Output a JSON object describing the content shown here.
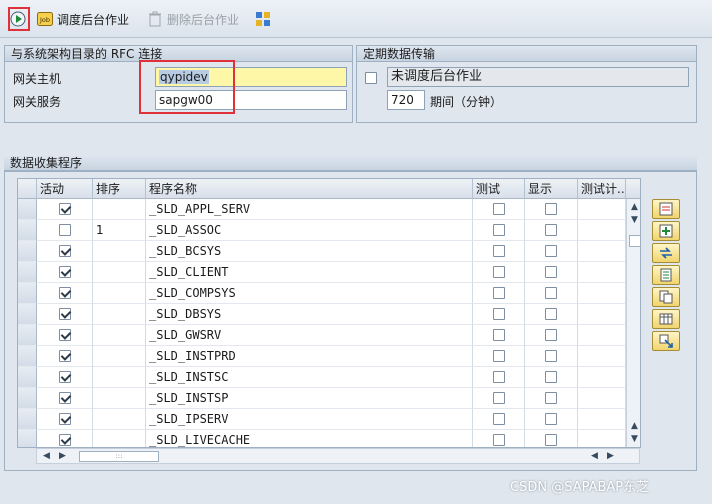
{
  "toolbar": {
    "schedule_label": "调度后台作业",
    "delete_label": "删除后台作业"
  },
  "rfc_group": {
    "title": "与系统架构目录的 RFC 连接",
    "host_label": "网关主机",
    "host_value": "qypidev",
    "service_label": "网关服务",
    "service_value": "sapgw00"
  },
  "periodic_group": {
    "title": "定期数据传输",
    "status_text": "未调度后台作业",
    "interval_value": "720",
    "interval_label": "期间（分钟）"
  },
  "collector_group": {
    "title": "数据收集程序",
    "columns": [
      "活动",
      "排序",
      "程序名称",
      "测试",
      "显示",
      "测试计..."
    ],
    "rows": [
      {
        "active": true,
        "order": "",
        "name": "_SLD_APPL_SERV",
        "test": false,
        "display": false
      },
      {
        "active": false,
        "order": "1",
        "name": "_SLD_ASSOC",
        "test": false,
        "display": false
      },
      {
        "active": true,
        "order": "",
        "name": "_SLD_BCSYS",
        "test": false,
        "display": false
      },
      {
        "active": true,
        "order": "",
        "name": "_SLD_CLIENT",
        "test": false,
        "display": false
      },
      {
        "active": true,
        "order": "",
        "name": "_SLD_COMPSYS",
        "test": false,
        "display": false
      },
      {
        "active": true,
        "order": "",
        "name": "_SLD_DBSYS",
        "test": false,
        "display": false
      },
      {
        "active": true,
        "order": "",
        "name": "_SLD_GWSRV",
        "test": false,
        "display": false
      },
      {
        "active": true,
        "order": "",
        "name": "_SLD_INSTPRD",
        "test": false,
        "display": false
      },
      {
        "active": true,
        "order": "",
        "name": "_SLD_INSTSC",
        "test": false,
        "display": false
      },
      {
        "active": true,
        "order": "",
        "name": "_SLD_INSTSP",
        "test": false,
        "display": false
      },
      {
        "active": true,
        "order": "",
        "name": "_SLD_IPSERV",
        "test": false,
        "display": false
      },
      {
        "active": true,
        "order": "",
        "name": "_SLD_LIVECACHE",
        "test": false,
        "display": false
      }
    ]
  },
  "watermark": "CSDN @SAPABAP东芝",
  "colors": {
    "accent_highlight": "#e0303a",
    "required_field": "#fff7a8",
    "side_button": "#f1d46e"
  },
  "icons": {
    "execute": "execute-icon",
    "job": "job-icon",
    "delete": "trash-icon",
    "layout": "layout-icon"
  }
}
